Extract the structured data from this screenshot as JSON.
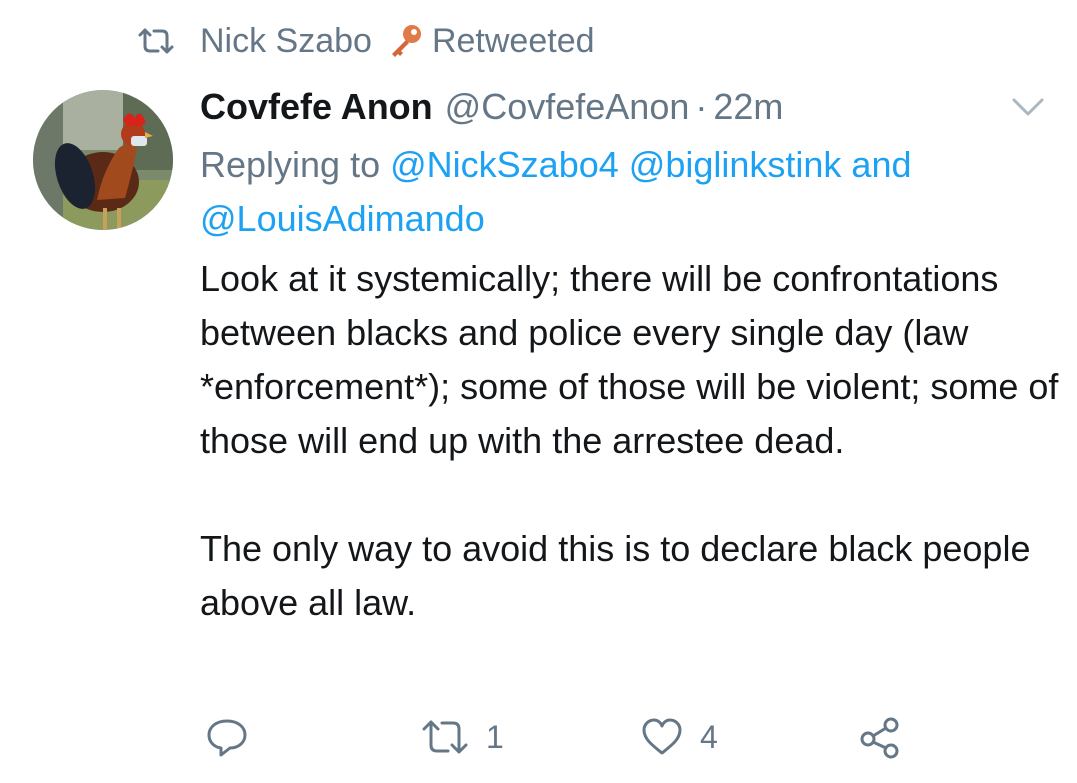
{
  "retweet_context": {
    "icon": "retweet-icon",
    "name": "Nick Szabo",
    "badge_icon": "key-icon",
    "label": "Retweeted"
  },
  "tweet": {
    "avatar_icon": "rooster-avatar",
    "author_name": "Covfefe Anon",
    "handle": "@CovfefeAnon",
    "separator": "·",
    "timestamp": "22m",
    "replying_prefix": "Replying to",
    "reply_mention_1": "@NickSzabo4",
    "reply_mention_2": "@biglinkstink",
    "reply_conjunction": "and",
    "reply_mention_3": "@LouisAdimando",
    "paragraph_1": "Look at it systemically; there will be confrontations between blacks and police every single day (law *enforcement*); some of those will be violent; some of those will end up with the arrestee dead.",
    "paragraph_2": "The only way to avoid this is to declare black people above all law."
  },
  "actions": {
    "reply_icon": "reply-icon",
    "retweet_icon": "retweet-icon",
    "retweet_count": "1",
    "like_icon": "heart-icon",
    "like_count": "4",
    "share_icon": "share-icon"
  },
  "colors": {
    "text": "#14171a",
    "secondary": "#657786",
    "link": "#1da1f2",
    "key": "#e07a47"
  }
}
